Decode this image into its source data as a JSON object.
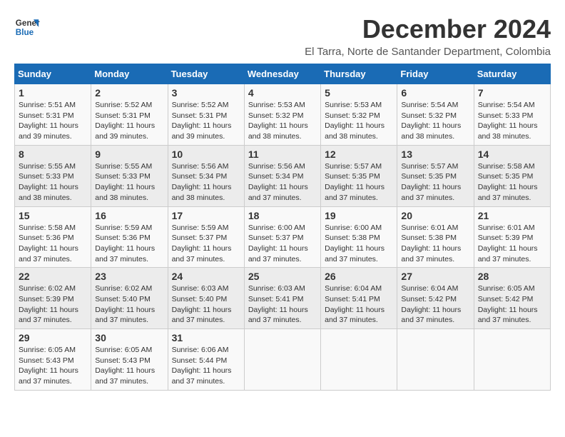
{
  "logo": {
    "line1": "General",
    "line2": "Blue"
  },
  "title": "December 2024",
  "subtitle": "El Tarra, Norte de Santander Department, Colombia",
  "weekdays": [
    "Sunday",
    "Monday",
    "Tuesday",
    "Wednesday",
    "Thursday",
    "Friday",
    "Saturday"
  ],
  "weeks": [
    [
      {
        "day": "1",
        "sunrise": "Sunrise: 5:51 AM",
        "sunset": "Sunset: 5:31 PM",
        "daylight": "Daylight: 11 hours and 39 minutes."
      },
      {
        "day": "2",
        "sunrise": "Sunrise: 5:52 AM",
        "sunset": "Sunset: 5:31 PM",
        "daylight": "Daylight: 11 hours and 39 minutes."
      },
      {
        "day": "3",
        "sunrise": "Sunrise: 5:52 AM",
        "sunset": "Sunset: 5:31 PM",
        "daylight": "Daylight: 11 hours and 39 minutes."
      },
      {
        "day": "4",
        "sunrise": "Sunrise: 5:53 AM",
        "sunset": "Sunset: 5:32 PM",
        "daylight": "Daylight: 11 hours and 38 minutes."
      },
      {
        "day": "5",
        "sunrise": "Sunrise: 5:53 AM",
        "sunset": "Sunset: 5:32 PM",
        "daylight": "Daylight: 11 hours and 38 minutes."
      },
      {
        "day": "6",
        "sunrise": "Sunrise: 5:54 AM",
        "sunset": "Sunset: 5:32 PM",
        "daylight": "Daylight: 11 hours and 38 minutes."
      },
      {
        "day": "7",
        "sunrise": "Sunrise: 5:54 AM",
        "sunset": "Sunset: 5:33 PM",
        "daylight": "Daylight: 11 hours and 38 minutes."
      }
    ],
    [
      {
        "day": "8",
        "sunrise": "Sunrise: 5:55 AM",
        "sunset": "Sunset: 5:33 PM",
        "daylight": "Daylight: 11 hours and 38 minutes."
      },
      {
        "day": "9",
        "sunrise": "Sunrise: 5:55 AM",
        "sunset": "Sunset: 5:33 PM",
        "daylight": "Daylight: 11 hours and 38 minutes."
      },
      {
        "day": "10",
        "sunrise": "Sunrise: 5:56 AM",
        "sunset": "Sunset: 5:34 PM",
        "daylight": "Daylight: 11 hours and 38 minutes."
      },
      {
        "day": "11",
        "sunrise": "Sunrise: 5:56 AM",
        "sunset": "Sunset: 5:34 PM",
        "daylight": "Daylight: 11 hours and 37 minutes."
      },
      {
        "day": "12",
        "sunrise": "Sunrise: 5:57 AM",
        "sunset": "Sunset: 5:35 PM",
        "daylight": "Daylight: 11 hours and 37 minutes."
      },
      {
        "day": "13",
        "sunrise": "Sunrise: 5:57 AM",
        "sunset": "Sunset: 5:35 PM",
        "daylight": "Daylight: 11 hours and 37 minutes."
      },
      {
        "day": "14",
        "sunrise": "Sunrise: 5:58 AM",
        "sunset": "Sunset: 5:35 PM",
        "daylight": "Daylight: 11 hours and 37 minutes."
      }
    ],
    [
      {
        "day": "15",
        "sunrise": "Sunrise: 5:58 AM",
        "sunset": "Sunset: 5:36 PM",
        "daylight": "Daylight: 11 hours and 37 minutes."
      },
      {
        "day": "16",
        "sunrise": "Sunrise: 5:59 AM",
        "sunset": "Sunset: 5:36 PM",
        "daylight": "Daylight: 11 hours and 37 minutes."
      },
      {
        "day": "17",
        "sunrise": "Sunrise: 5:59 AM",
        "sunset": "Sunset: 5:37 PM",
        "daylight": "Daylight: 11 hours and 37 minutes."
      },
      {
        "day": "18",
        "sunrise": "Sunrise: 6:00 AM",
        "sunset": "Sunset: 5:37 PM",
        "daylight": "Daylight: 11 hours and 37 minutes."
      },
      {
        "day": "19",
        "sunrise": "Sunrise: 6:00 AM",
        "sunset": "Sunset: 5:38 PM",
        "daylight": "Daylight: 11 hours and 37 minutes."
      },
      {
        "day": "20",
        "sunrise": "Sunrise: 6:01 AM",
        "sunset": "Sunset: 5:38 PM",
        "daylight": "Daylight: 11 hours and 37 minutes."
      },
      {
        "day": "21",
        "sunrise": "Sunrise: 6:01 AM",
        "sunset": "Sunset: 5:39 PM",
        "daylight": "Daylight: 11 hours and 37 minutes."
      }
    ],
    [
      {
        "day": "22",
        "sunrise": "Sunrise: 6:02 AM",
        "sunset": "Sunset: 5:39 PM",
        "daylight": "Daylight: 11 hours and 37 minutes."
      },
      {
        "day": "23",
        "sunrise": "Sunrise: 6:02 AM",
        "sunset": "Sunset: 5:40 PM",
        "daylight": "Daylight: 11 hours and 37 minutes."
      },
      {
        "day": "24",
        "sunrise": "Sunrise: 6:03 AM",
        "sunset": "Sunset: 5:40 PM",
        "daylight": "Daylight: 11 hours and 37 minutes."
      },
      {
        "day": "25",
        "sunrise": "Sunrise: 6:03 AM",
        "sunset": "Sunset: 5:41 PM",
        "daylight": "Daylight: 11 hours and 37 minutes."
      },
      {
        "day": "26",
        "sunrise": "Sunrise: 6:04 AM",
        "sunset": "Sunset: 5:41 PM",
        "daylight": "Daylight: 11 hours and 37 minutes."
      },
      {
        "day": "27",
        "sunrise": "Sunrise: 6:04 AM",
        "sunset": "Sunset: 5:42 PM",
        "daylight": "Daylight: 11 hours and 37 minutes."
      },
      {
        "day": "28",
        "sunrise": "Sunrise: 6:05 AM",
        "sunset": "Sunset: 5:42 PM",
        "daylight": "Daylight: 11 hours and 37 minutes."
      }
    ],
    [
      {
        "day": "29",
        "sunrise": "Sunrise: 6:05 AM",
        "sunset": "Sunset: 5:43 PM",
        "daylight": "Daylight: 11 hours and 37 minutes."
      },
      {
        "day": "30",
        "sunrise": "Sunrise: 6:05 AM",
        "sunset": "Sunset: 5:43 PM",
        "daylight": "Daylight: 11 hours and 37 minutes."
      },
      {
        "day": "31",
        "sunrise": "Sunrise: 6:06 AM",
        "sunset": "Sunset: 5:44 PM",
        "daylight": "Daylight: 11 hours and 37 minutes."
      },
      null,
      null,
      null,
      null
    ]
  ]
}
